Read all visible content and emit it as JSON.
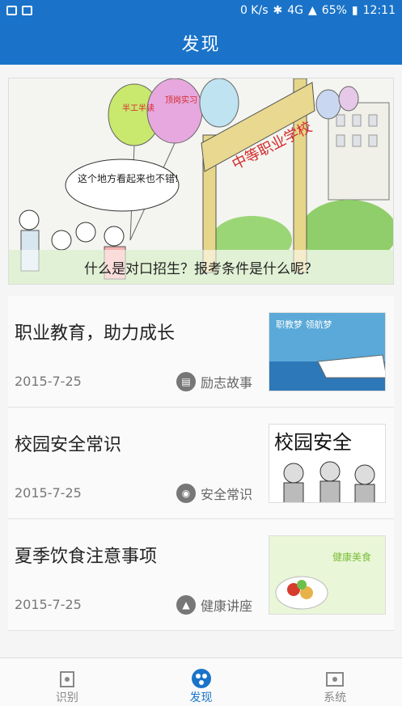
{
  "status": {
    "speed": "0 K/s",
    "battery": "65%",
    "time": "12:11",
    "network": "4G"
  },
  "header": {
    "title": "发现"
  },
  "banner": {
    "caption": "什么是对口招生？报考条件是什么呢？",
    "sign_text": "中等职业学校",
    "bubble_text": "这个地方看起来也不错!",
    "balloon_1": "半工半读",
    "balloon_2": "顶岗实习"
  },
  "news": [
    {
      "title": "职业教育，助力成长",
      "date": "2015-7-25",
      "tag": "励志故事",
      "tag_icon": "book-icon",
      "thumb_text": "职教梦  领航梦"
    },
    {
      "title": "校园安全常识",
      "date": "2015-7-25",
      "tag": "安全常识",
      "tag_icon": "camera-icon",
      "thumb_text": "校园安全"
    },
    {
      "title": "夏季饮食注意事项",
      "date": "2015-7-25",
      "tag": "健康讲座",
      "tag_icon": "graduation-cap-icon",
      "thumb_text": "健康美食"
    }
  ],
  "tabs": [
    {
      "label": "识别",
      "icon": "scan-icon",
      "active": false
    },
    {
      "label": "发现",
      "icon": "discover-icon",
      "active": true
    },
    {
      "label": "系统",
      "icon": "folder-icon",
      "active": false
    }
  ],
  "colors": {
    "primary": "#1a73c9"
  }
}
